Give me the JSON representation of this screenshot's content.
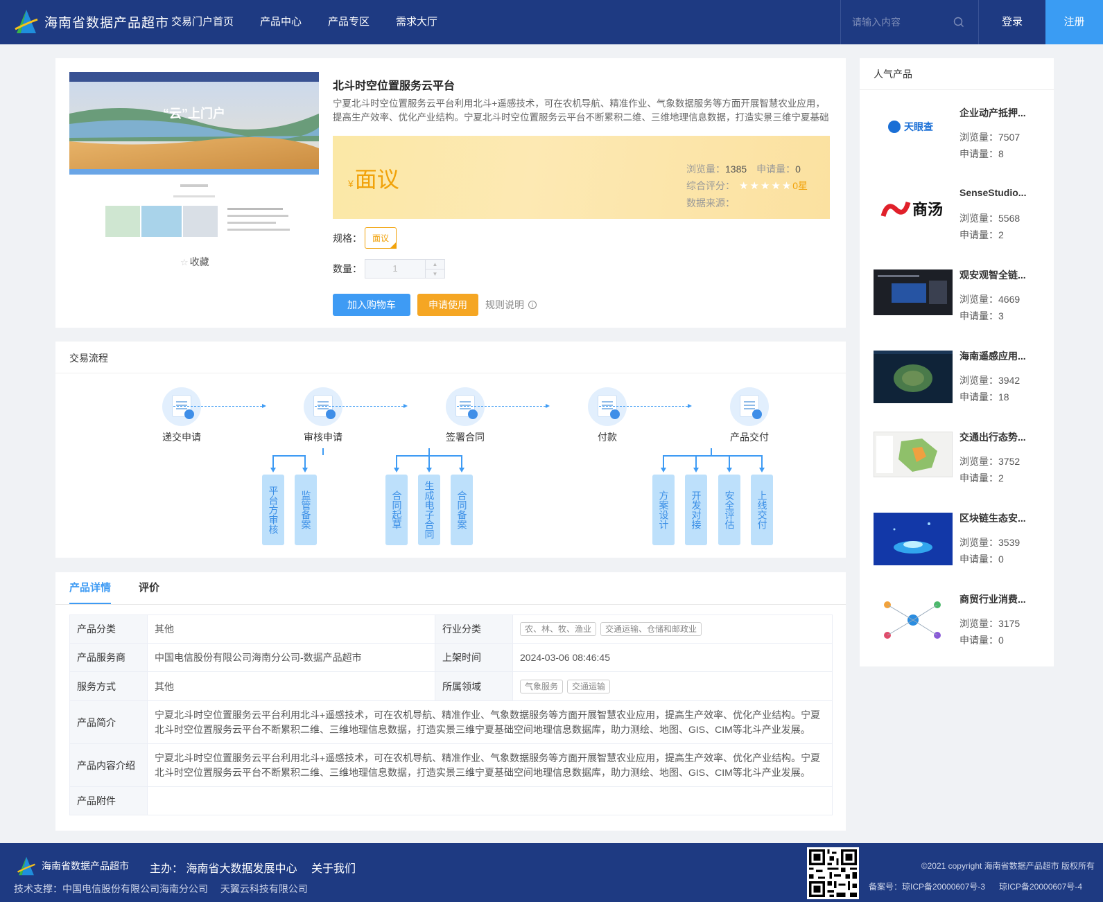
{
  "header": {
    "site_title": "海南省数据产品超市",
    "nav": [
      "交易门户首页",
      "产品中心",
      "产品专区",
      "需求大厅"
    ],
    "search_placeholder": "请输入内容",
    "login": "登录",
    "register": "注册"
  },
  "product": {
    "favorite": "收藏",
    "title": "北斗时空位置服务云平台",
    "desc": "宁夏北斗时空位置服务云平台利用北斗+遥感技术，可在农机导航、精准作业、气象数据服务等方面开展智慧农业应用，提高生产效率、优化产业结构。宁夏北斗时空位置服务云平台不断累积二维、三维地理信息数据，打造实景三维宁夏基础空间地理信息数据库，助力测绘、地图、GIS、CIM等北斗产业发展。",
    "price_symbol": "¥",
    "price": "面议",
    "views_label": "浏览量：",
    "views": "1385",
    "applies_label": "申请量：",
    "applies": "0",
    "rating_label": "综合评分：",
    "stars": "★★★★★",
    "rating_value": "0星",
    "source_label": "数据来源：",
    "spec_label": "规格：",
    "spec_value": "面议",
    "qty_label": "数量：",
    "qty_value": "1",
    "add_cart": "加入购物车",
    "apply": "申请使用",
    "rules": "规则说明",
    "image_caption": "“云”上门户"
  },
  "flow": {
    "title": "交易流程",
    "steps": [
      "递交申请",
      "审核申请",
      "签署合同",
      "付款",
      "产品交付"
    ],
    "sub_review": [
      "平台方审核",
      "监管备案"
    ],
    "sub_contract": [
      "合同起草",
      "生成电子合同",
      "合同备案"
    ],
    "sub_delivery": [
      "方案设计",
      "开发对接",
      "安全评估",
      "上线交付"
    ]
  },
  "details": {
    "tabs": [
      "产品详情",
      "评价"
    ],
    "rows": {
      "category_k": "产品分类",
      "category_v": "其他",
      "industry_k": "行业分类",
      "industry_tags": [
        "农、林、牧、渔业",
        "交通运输、仓储和邮政业"
      ],
      "provider_k": "产品服务商",
      "provider_v": "中国电信股份有限公司海南分公司-数据产品超市",
      "listed_k": "上架时间",
      "listed_v": "2024-03-06 08:46:45",
      "service_k": "服务方式",
      "service_v": "其他",
      "domain_k": "所属领域",
      "domain_tags": [
        "气象服务",
        "交通运输"
      ],
      "intro_k": "产品简介",
      "intro_v": "宁夏北斗时空位置服务云平台利用北斗+遥感技术，可在农机导航、精准作业、气象数据服务等方面开展智慧农业应用，提高生产效率、优化产业结构。宁夏北斗时空位置服务云平台不断累积二维、三维地理信息数据，打造实景三维宁夏基础空间地理信息数据库，助力测绘、地图、GIS、CIM等北斗产业发展。",
      "content_k": "产品内容介绍",
      "content_v": "宁夏北斗时空位置服务云平台利用北斗+遥感技术，可在农机导航、精准作业、气象数据服务等方面开展智慧农业应用，提高生产效率、优化产业结构。宁夏北斗时空位置服务云平台不断累积二维、三维地理信息数据，打造实景三维宁夏基础空间地理信息数据库，助力测绘、地图、GIS、CIM等北斗产业发展。",
      "attach_k": "产品附件"
    }
  },
  "sidebar": {
    "title": "人气产品",
    "items": [
      {
        "name": "企业动产抵押...",
        "views": "浏览量：7507",
        "applies": "申请量：8",
        "thumb": "天眼查"
      },
      {
        "name": "SenseStudio...",
        "views": "浏览量：5568",
        "applies": "申请量：2",
        "thumb": "商汤"
      },
      {
        "name": "观安观智全链...",
        "views": "浏览量：4669",
        "applies": "申请量：3",
        "thumb": ""
      },
      {
        "name": "海南遥感应用...",
        "views": "浏览量：3942",
        "applies": "申请量：18",
        "thumb": ""
      },
      {
        "name": "交通出行态势...",
        "views": "浏览量：3752",
        "applies": "申请量：2",
        "thumb": ""
      },
      {
        "name": "区块链生态安...",
        "views": "浏览量：3539",
        "applies": "申请量：0",
        "thumb": ""
      },
      {
        "name": "商贸行业消费...",
        "views": "浏览量：3175",
        "applies": "申请量：0",
        "thumb": ""
      }
    ]
  },
  "footer": {
    "site_title": "海南省数据产品超市",
    "host": "主办： 海南省大数据发展中心",
    "about": "关于我们",
    "tech": "技术支撑：中国电信股份有限公司海南分公司 　天翼云科技有限公司",
    "copyright": "©2021 copyright 海南省数据产品超市 版权所有",
    "icp1": "备案号：琼ICP备20000607号-3",
    "icp2": "琼ICP备20000607号-4"
  },
  "colors": {
    "header_bg": "#1e3a82",
    "accent_blue": "#3e9bf4",
    "accent_orange": "#f5a623"
  }
}
